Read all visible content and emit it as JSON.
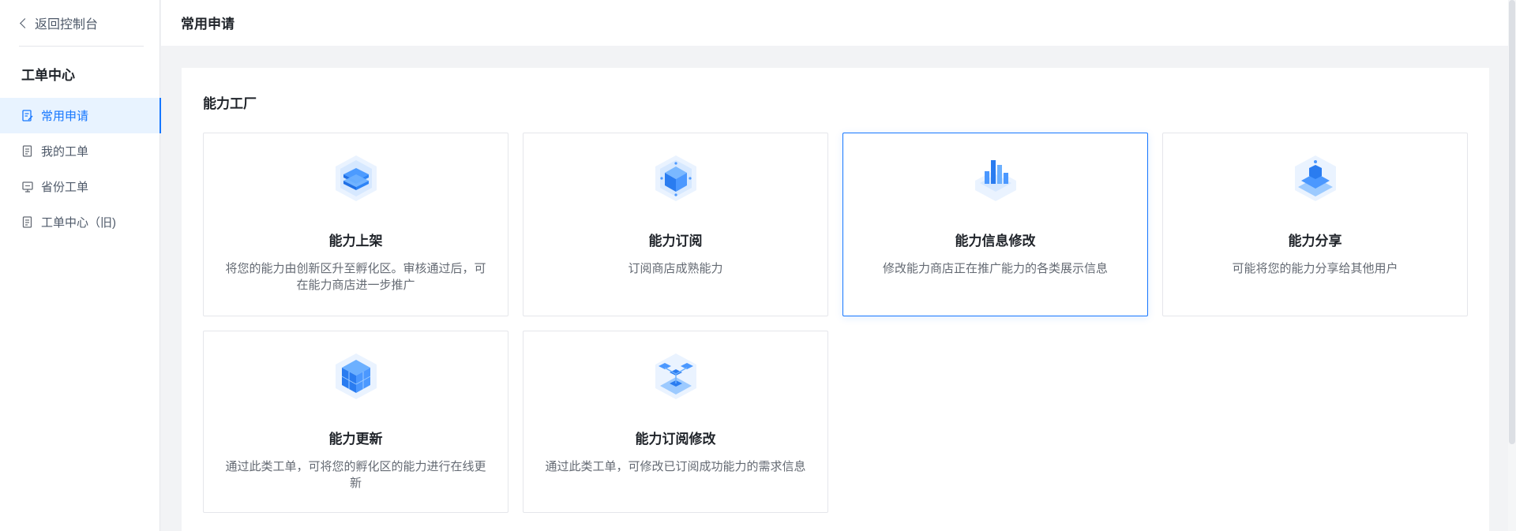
{
  "sidebar": {
    "back_label": "返回控制台",
    "section_title": "工单中心",
    "items": [
      {
        "label": "常用申请",
        "icon": "edit-doc-icon",
        "active": true
      },
      {
        "label": "我的工单",
        "icon": "doc-list-icon",
        "active": false
      },
      {
        "label": "省份工单",
        "icon": "monitor-icon",
        "active": false
      },
      {
        "label": "工单中心（旧)",
        "icon": "doc-list-icon",
        "active": false
      }
    ]
  },
  "header": {
    "title": "常用申请"
  },
  "main": {
    "section_title": "能力工厂",
    "cards": [
      {
        "title": "能力上架",
        "desc": "将您的能力由创新区升至孵化区。审核通过后，可在能力商店进一步推广",
        "icon": "stack-layers-icon"
      },
      {
        "title": "能力订阅",
        "desc": "订阅商店成熟能力",
        "icon": "cube-icon"
      },
      {
        "title": "能力信息修改",
        "desc": "修改能力商店正在推广能力的各类展示信息",
        "icon": "bar-chart-icon"
      },
      {
        "title": "能力分享",
        "desc": "可能将您的能力分享给其他用户",
        "icon": "share-platform-icon"
      },
      {
        "title": "能力更新",
        "desc": "通过此类工单，可将您的孵化区的能力进行在线更新",
        "icon": "cube-grid-icon"
      },
      {
        "title": "能力订阅修改",
        "desc": "通过此类工单，可修改已订阅成功能力的需求信息",
        "icon": "network-icon"
      }
    ]
  },
  "colors": {
    "accent": "#1677ff",
    "active_bg": "#e8f3ff",
    "page_bg": "#f2f3f5"
  }
}
